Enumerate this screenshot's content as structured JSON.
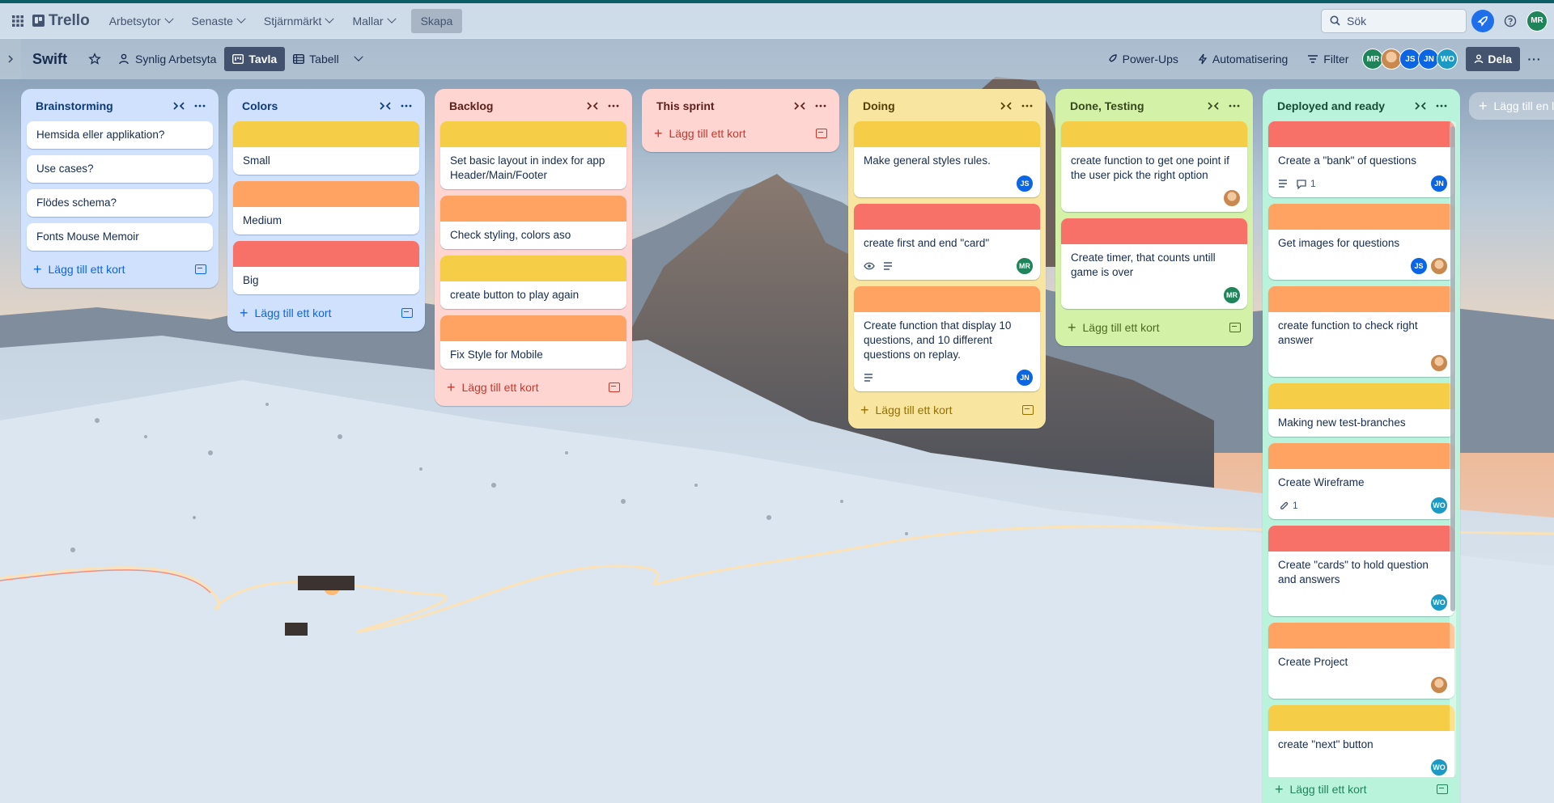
{
  "topbar": {
    "app_name": "Trello",
    "menus": [
      "Arbetsytor",
      "Senaste",
      "Stjärnmärkt",
      "Mallar"
    ],
    "create_label": "Skapa",
    "search_placeholder": "Sök",
    "user_initials": "MR"
  },
  "board": {
    "title": "Swift",
    "visibility_label": "Synlig Arbetsyta",
    "views": [
      "Tavla",
      "Tabell"
    ],
    "powerups_label": "Power-Ups",
    "automation_label": "Automatisering",
    "filter_label": "Filter",
    "share_label": "Dela",
    "members": [
      "MR",
      "",
      "JS",
      "JN",
      "WO"
    ]
  },
  "add_card_label": "Lägg till ett kort",
  "add_list_label": "Lägg till en li",
  "colors": {
    "yellow": "#f5cd47",
    "orange": "#fea362",
    "red": "#f87168",
    "mr": "#1f845a",
    "js": "#0c66e4",
    "jn": "#0c66e4",
    "wo": "#1d9ac4"
  },
  "lists": [
    {
      "title": "Brainstorming",
      "cards": [
        {
          "text": "Hemsida eller applikation?"
        },
        {
          "text": "Use cases?"
        },
        {
          "text": "Flödes schema?"
        },
        {
          "text": "Fonts Mouse Memoir"
        }
      ]
    },
    {
      "title": "Colors",
      "cards": [
        {
          "text": "Small",
          "cover": "yellow"
        },
        {
          "text": "Medium",
          "cover": "orange"
        },
        {
          "text": "Big",
          "cover": "red"
        }
      ]
    },
    {
      "title": "Backlog",
      "cards": [
        {
          "text": "Set basic layout in index for app Header/Main/Footer",
          "cover": "yellow"
        },
        {
          "text": "Check styling, colors aso",
          "cover": "orange"
        },
        {
          "text": "create button to play again",
          "cover": "yellow"
        },
        {
          "text": "Fix Style for Mobile",
          "cover": "orange"
        }
      ]
    },
    {
      "title": "This sprint",
      "cards": []
    },
    {
      "title": "Doing",
      "cards": [
        {
          "text": "Make general styles rules.",
          "cover": "yellow",
          "members": [
            "JS"
          ]
        },
        {
          "text": "create first and end \"card\"",
          "cover": "red",
          "watch": true,
          "desc": true,
          "members": [
            "MR"
          ]
        },
        {
          "text": "Create function that display 10 questions, and 10 different questions on replay.",
          "cover": "orange",
          "desc": true,
          "members": [
            "JN"
          ]
        }
      ]
    },
    {
      "title": "Done, Testing",
      "cards": [
        {
          "text": "create function to get one point if the user pick the right option",
          "cover": "yellow",
          "members": [
            "PHOTO"
          ]
        },
        {
          "text": "Create timer, that counts untill game is over",
          "cover": "red",
          "members": [
            "MR"
          ]
        }
      ]
    },
    {
      "title": "Deployed and ready",
      "cards": [
        {
          "text": "Create a \"bank\" of questions",
          "cover": "red",
          "desc": true,
          "comments": "1",
          "members": [
            "JN"
          ]
        },
        {
          "text": "Get images for questions",
          "cover": "orange",
          "members": [
            "JS",
            "PHOTO"
          ]
        },
        {
          "text": "create function to check right answer",
          "cover": "orange",
          "members": [
            "PHOTO"
          ]
        },
        {
          "text": "Making new test-branches",
          "cover": "yellow"
        },
        {
          "text": "Create Wireframe",
          "cover": "orange",
          "attachments": "1",
          "members": [
            "WO"
          ]
        },
        {
          "text": "Create \"cards\" to hold question and answers",
          "cover": "red",
          "members": [
            "WO"
          ]
        },
        {
          "text": "Create Project",
          "cover": "orange",
          "members": [
            "PHOTO"
          ]
        },
        {
          "text": "create \"next\" button",
          "cover": "yellow",
          "members": [
            "WO"
          ]
        }
      ]
    }
  ]
}
